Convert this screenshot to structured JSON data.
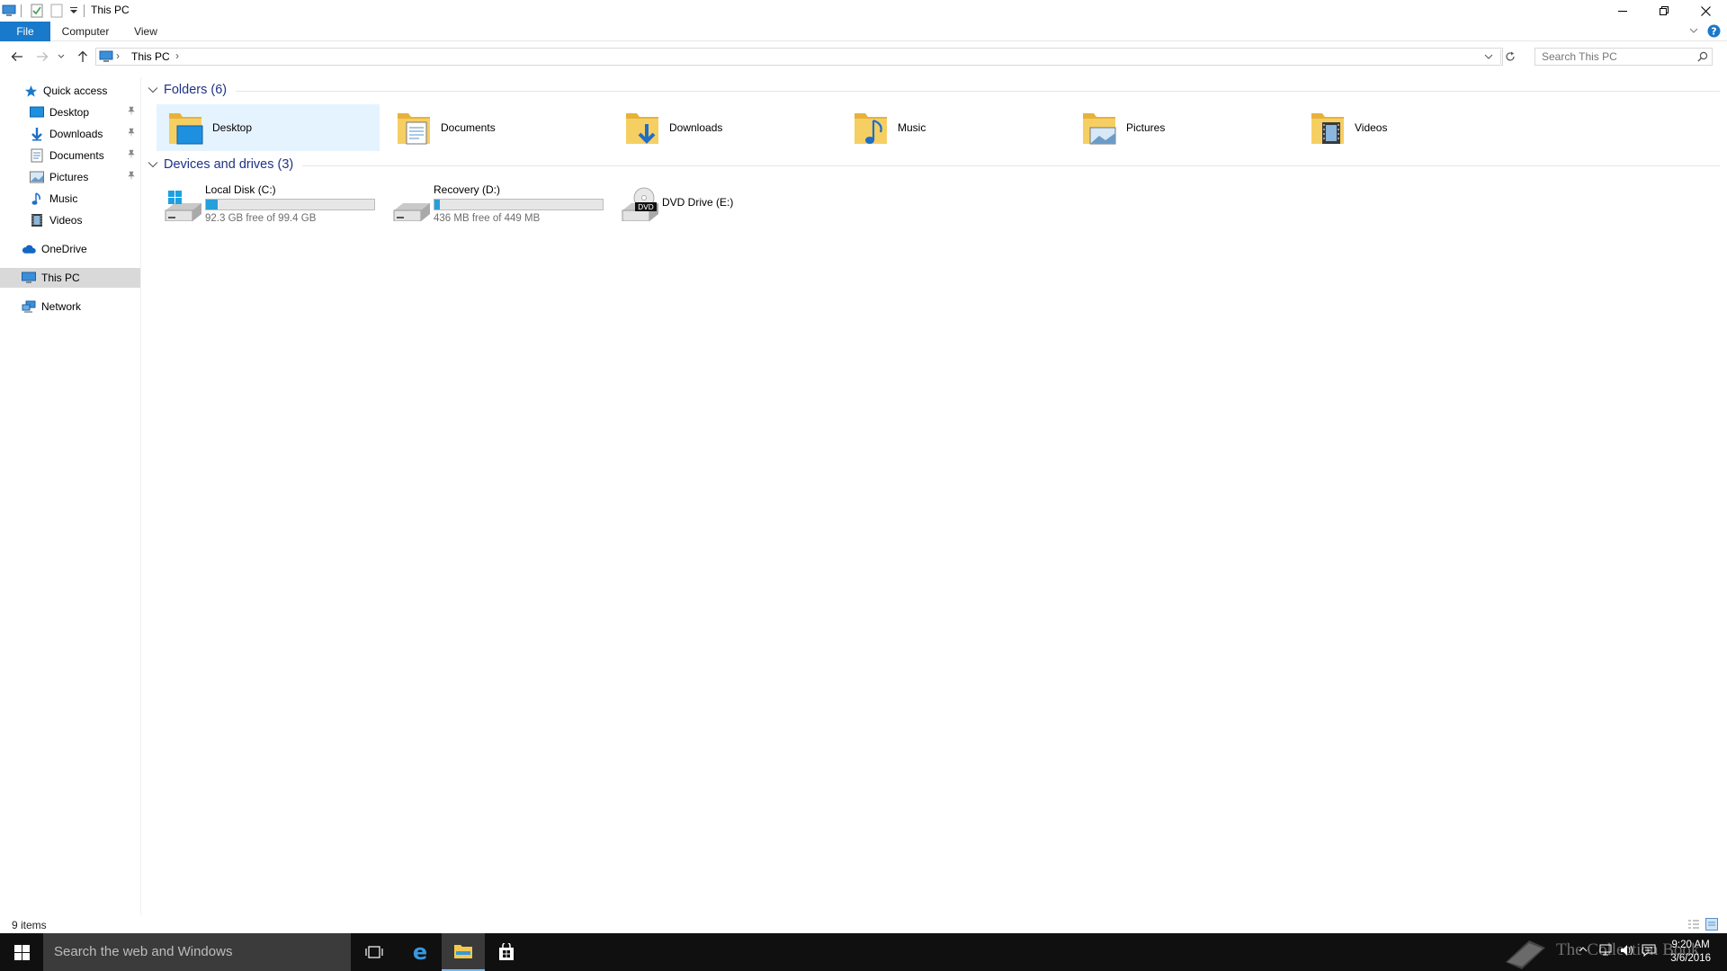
{
  "window": {
    "title": "This PC",
    "ribbon_tabs": [
      "File",
      "Computer",
      "View"
    ]
  },
  "address": {
    "path": "This PC",
    "separator": "›"
  },
  "search": {
    "placeholder": "Search This PC"
  },
  "sidebar": {
    "quick_access": "Quick access",
    "items": [
      {
        "label": "Desktop",
        "icon": "desktop-icon",
        "pinned": true
      },
      {
        "label": "Downloads",
        "icon": "downloads-icon",
        "pinned": true
      },
      {
        "label": "Documents",
        "icon": "documents-icon",
        "pinned": true
      },
      {
        "label": "Pictures",
        "icon": "pictures-icon",
        "pinned": true
      },
      {
        "label": "Music",
        "icon": "music-icon",
        "pinned": false
      },
      {
        "label": "Videos",
        "icon": "videos-icon",
        "pinned": false
      }
    ],
    "onedrive": "OneDrive",
    "this_pc": "This PC",
    "network": "Network"
  },
  "main": {
    "folders_header": "Folders (6)",
    "folders": [
      {
        "label": "Desktop",
        "icon": "desktop-folder-icon"
      },
      {
        "label": "Documents",
        "icon": "documents-folder-icon"
      },
      {
        "label": "Downloads",
        "icon": "downloads-folder-icon"
      },
      {
        "label": "Music",
        "icon": "music-folder-icon"
      },
      {
        "label": "Pictures",
        "icon": "pictures-folder-icon"
      },
      {
        "label": "Videos",
        "icon": "videos-folder-icon"
      }
    ],
    "drives_header": "Devices and drives (3)",
    "drives": [
      {
        "name": "Local Disk (C:)",
        "free": "92.3 GB free of 99.4 GB",
        "used_fraction": 0.07,
        "icon": "windows-drive-icon"
      },
      {
        "name": "Recovery (D:)",
        "free": "436 MB free of 449 MB",
        "used_fraction": 0.03,
        "icon": "drive-icon"
      },
      {
        "name": "DVD Drive (E:)",
        "icon": "dvd-drive-icon"
      }
    ]
  },
  "status": {
    "items": "9 items"
  },
  "taskbar": {
    "search_placeholder": "Search the web and Windows",
    "watermark": "The Collection Book",
    "time": "9:20 AM",
    "date": "3/6/2016"
  },
  "colors": {
    "accent": "#1979ca",
    "header_blue": "#1e3287",
    "drive_bar": "#26a0da",
    "folder_yellow": "#f2c94c",
    "taskbar": "#101010"
  }
}
